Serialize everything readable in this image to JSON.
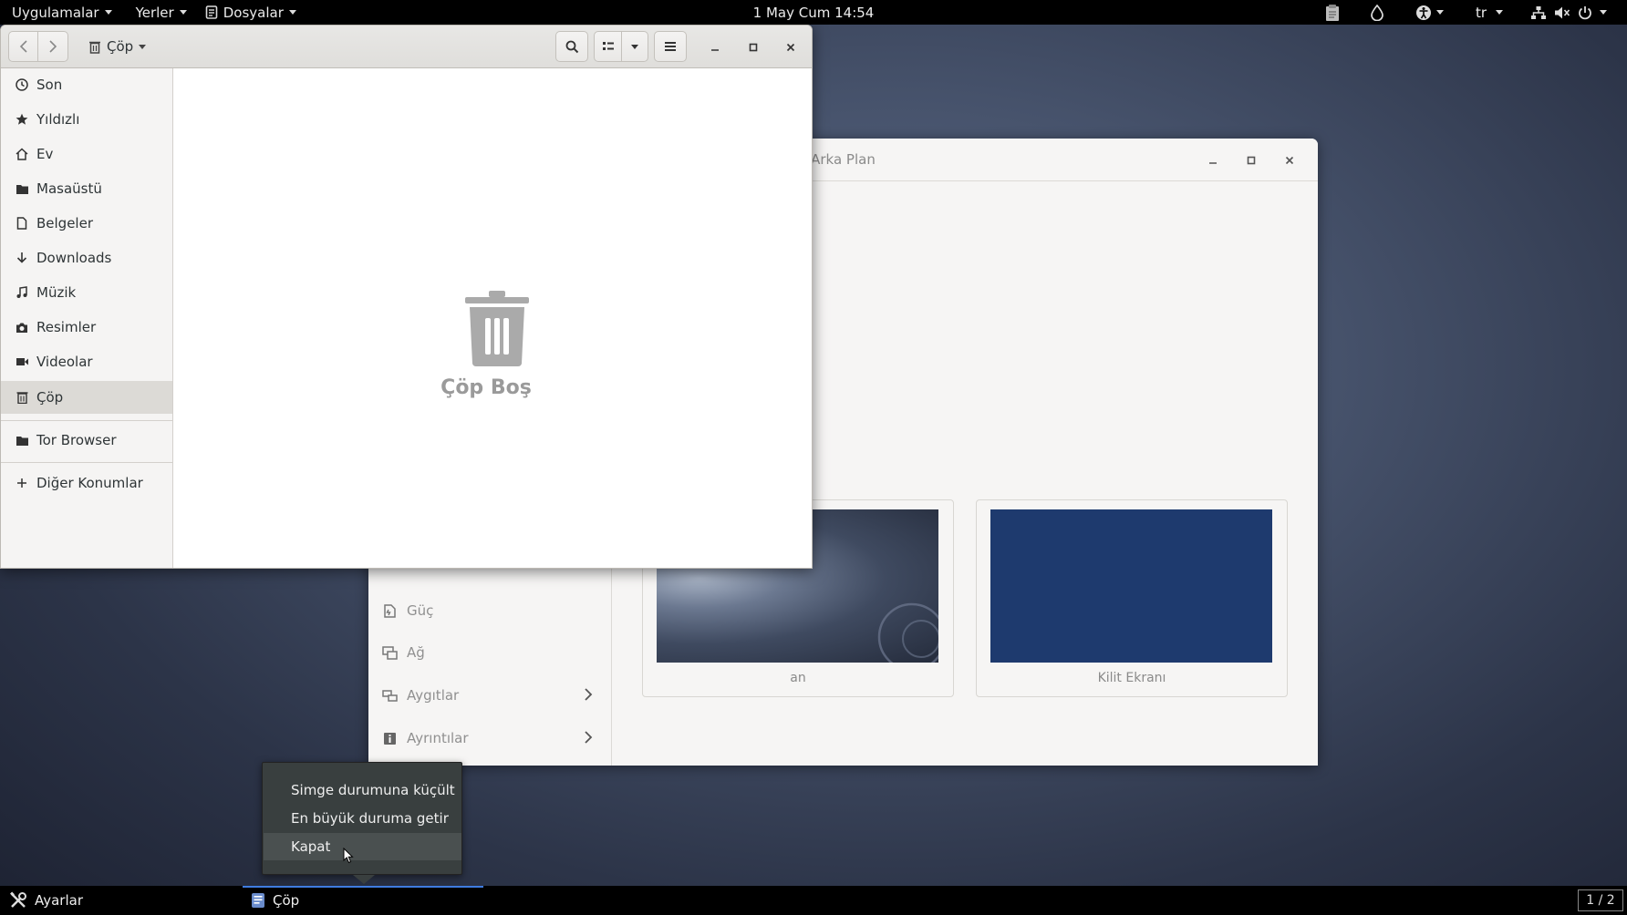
{
  "topbar": {
    "applications": "Uygulamalar",
    "places": "Yerler",
    "files_app": "Dosyalar",
    "clock": "1 May Cum  14:54",
    "language": "tr"
  },
  "settings_window": {
    "title": "Arka Plan",
    "sidebar": [
      {
        "label": "Güç",
        "icon": "power-plug-icon"
      },
      {
        "label": "Ağ",
        "icon": "network-icon"
      },
      {
        "label": "Aygıtlar",
        "icon": "devices-icon",
        "has_submenu": true
      },
      {
        "label": "Ayrıntılar",
        "icon": "info-icon",
        "has_submenu": true
      }
    ],
    "cards": [
      {
        "label": "an",
        "preview": "debian-desktop-wallpaper"
      },
      {
        "label": "Kilit Ekranı",
        "preview": "solid-blue",
        "color": "#1e3a6e"
      }
    ]
  },
  "files_window": {
    "location": "Çöp",
    "sidebar": [
      {
        "label": "Son",
        "icon": "recent-icon"
      },
      {
        "label": "Yıldızlı",
        "icon": "star-icon"
      },
      {
        "label": "Ev",
        "icon": "home-icon"
      },
      {
        "label": "Masaüstü",
        "icon": "folder-icon"
      },
      {
        "label": "Belgeler",
        "icon": "document-icon"
      },
      {
        "label": "Downloads",
        "icon": "download-icon"
      },
      {
        "label": "Müzik",
        "icon": "music-icon"
      },
      {
        "label": "Resimler",
        "icon": "camera-icon"
      },
      {
        "label": "Videolar",
        "icon": "video-icon"
      },
      {
        "label": "Çöp",
        "icon": "trash-icon",
        "active": true
      },
      {
        "label": "Tor Browser",
        "icon": "folder-icon"
      },
      {
        "label": "Diğer Konumlar",
        "icon": "plus-icon"
      }
    ],
    "empty_message": "Çöp Boş"
  },
  "context_menu": {
    "items": [
      "Simge durumuna küçült",
      "En büyük duruma getir",
      "Kapat"
    ],
    "hovered": "Kapat"
  },
  "taskbar": {
    "items": [
      {
        "label": "Ayarlar",
        "icon": "settings-tools-icon"
      },
      {
        "label": "Çöp",
        "icon": "files-app-icon",
        "active": true
      }
    ],
    "workspace": "1 / 2"
  },
  "colors": {
    "accent": "#3f7ce0",
    "lock_screen_blue": "#1e3a6e",
    "topbar": "#000000"
  }
}
